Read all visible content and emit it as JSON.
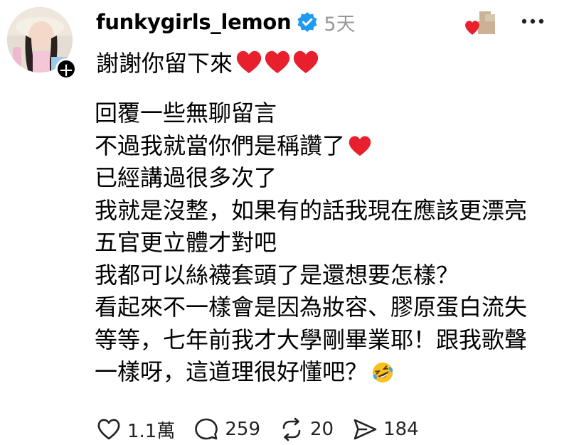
{
  "post": {
    "username": "funkygirls_lemon",
    "time": "5天",
    "caption": "謝謝你留下來",
    "lines": [
      "回覆一些無聊留言",
      "不過我就當你們是稱讚了",
      "已經講過很多次了",
      "我就是沒整，如果有的話我現在應該更漂亮",
      "五官更立體才對吧",
      "我都可以絲襪套頭了是還想要怎樣？",
      "看起來不一樣會是因為妝容、膠原蛋白流失",
      "等等，七年前我才大學剛畢業耶！跟我歌聲",
      "一樣呀，這道理很好懂吧？"
    ]
  },
  "actions": {
    "likes": "1.1萬",
    "comments": "259",
    "reposts": "20",
    "shares": "184"
  },
  "icons": {
    "verified": "verified-badge-icon",
    "heart": "red-heart-emoji",
    "laugh": "rolling-laughing-emoji",
    "like": "heart-outline-icon",
    "comment": "comment-bubble-icon",
    "repost": "repost-icon",
    "share": "send-icon",
    "more": "more-dots-icon"
  },
  "colors": {
    "verified_blue": "#1d9bf0",
    "heart_red": "#e8202e",
    "time_gray": "#999999"
  }
}
